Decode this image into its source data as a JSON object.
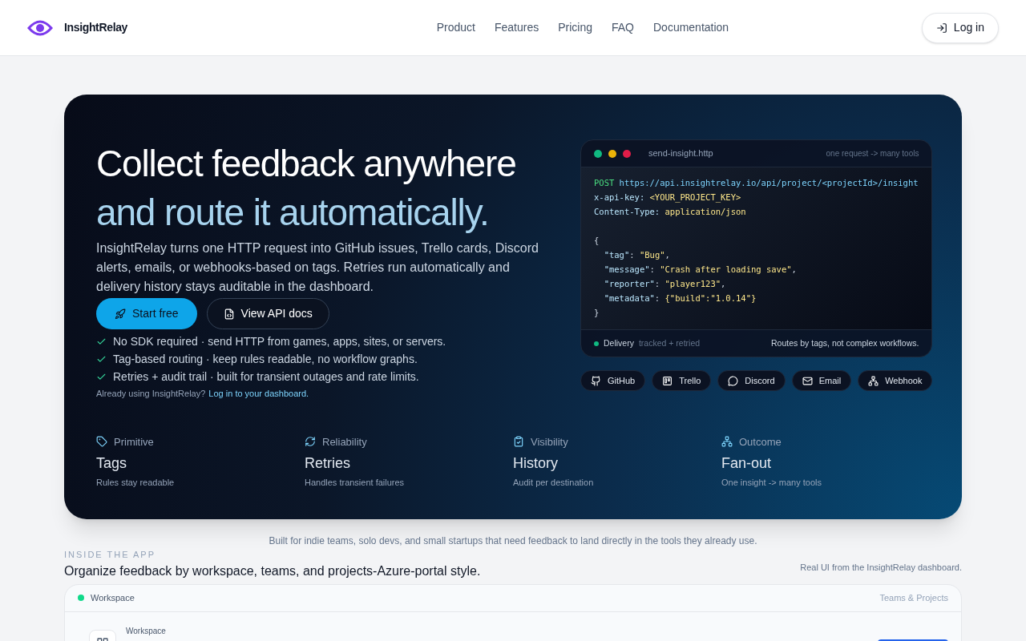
{
  "header": {
    "brand": "InsightRelay",
    "nav": [
      "Product",
      "Features",
      "Pricing",
      "FAQ",
      "Documentation"
    ],
    "login": "Log in"
  },
  "hero": {
    "title_line1": "Collect feedback anywhere",
    "title_line2": "and route it automatically.",
    "description": "InsightRelay turns one HTTP request into GitHub issues, Trello cards, Discord alerts, emails, or webhooks-based on tags. Retries run automatically and delivery history stays auditable in the dashboard.",
    "buttons": [
      {
        "label": "Start free",
        "kind": "primary"
      },
      {
        "label": "View API docs",
        "kind": "secondary"
      }
    ],
    "checks": [
      "No SDK required · send HTTP from games, apps, sites, or servers.",
      "Tag-based routing · keep rules readable, no workflow graphs.",
      "Retries + audit trail · built for transient outages and rate limits."
    ],
    "already": "Already using InsightRelay?",
    "already_link": "Log in to your dashboard.",
    "code_card": {
      "dots": [
        {
          "color": "#10b981"
        },
        {
          "color": "#eab308"
        },
        {
          "color": "#e11d48"
        }
      ],
      "filename": "send-insight.http",
      "tagline": "one request -> many tools",
      "lines": [
        {
          "kind": "code",
          "tokens": [
            {
              "text": "POST ",
              "kind": "method"
            },
            {
              "text": "https://api.insightrelay.io/api/project/<projectId>/insight",
              "kind": "url"
            }
          ]
        },
        {
          "kind": "code",
          "tokens": [
            {
              "text": "x-api-key: ",
              "kind": "key"
            },
            {
              "text": "<YOUR_PROJECT_KEY>",
              "kind": "value"
            }
          ]
        },
        {
          "kind": "code",
          "tokens": [
            {
              "text": "Content-Type: ",
              "kind": "key"
            },
            {
              "text": "application/json",
              "kind": "value"
            }
          ]
        },
        {
          "kind": "blank"
        },
        {
          "kind": "code",
          "tokens": [
            {
              "text": "{",
              "kind": "punct"
            }
          ]
        },
        {
          "kind": "code",
          "tokens": [
            {
              "text": "  \"tag\"",
              "kind": "key"
            },
            {
              "text": ": ",
              "kind": "punct"
            },
            {
              "text": "\"Bug\"",
              "kind": "value"
            },
            {
              "text": ",",
              "kind": "punct"
            }
          ]
        },
        {
          "kind": "code",
          "tokens": [
            {
              "text": "  \"message\"",
              "kind": "key"
            },
            {
              "text": ": ",
              "kind": "punct"
            },
            {
              "text": "\"Crash after loading save\"",
              "kind": "value"
            },
            {
              "text": ",",
              "kind": "punct"
            }
          ]
        },
        {
          "kind": "code",
          "tokens": [
            {
              "text": "  \"reporter\"",
              "kind": "key"
            },
            {
              "text": ": ",
              "kind": "punct"
            },
            {
              "text": "\"player123\"",
              "kind": "value"
            },
            {
              "text": ",",
              "kind": "punct"
            }
          ]
        },
        {
          "kind": "code",
          "tokens": [
            {
              "text": "  \"metadata\"",
              "kind": "key"
            },
            {
              "text": ": ",
              "kind": "punct"
            },
            {
              "text": "{\"build\":\"1.0.14\"}",
              "kind": "value"
            }
          ]
        },
        {
          "kind": "code",
          "tokens": [
            {
              "text": "}",
              "kind": "punct"
            }
          ]
        }
      ],
      "footer_label": "Delivery",
      "footer_status": "tracked + retried",
      "footer_note": "Routes by tags, not complex workflows."
    },
    "integrations": [
      {
        "label": "GitHub",
        "kind": "github"
      },
      {
        "label": "Trello",
        "kind": "trello"
      },
      {
        "label": "Discord",
        "kind": "discord"
      },
      {
        "label": "Email",
        "kind": "email"
      },
      {
        "label": "Webhook",
        "kind": "webhook"
      }
    ],
    "stats": [
      {
        "kind": "tag",
        "label": "Primitive",
        "value": "Tags",
        "note": "Rules stay readable"
      },
      {
        "kind": "retry",
        "label": "Reliability",
        "value": "Retries",
        "note": "Handles transient failures"
      },
      {
        "kind": "history",
        "label": "Visibility",
        "value": "History",
        "note": "Audit per destination"
      },
      {
        "kind": "outcome",
        "label": "Outcome",
        "value": "Fan-out",
        "note": "One insight -> many tools"
      }
    ]
  },
  "caption": "Built for indie teams, solo devs, and small startups that need feedback to land directly in the tools they already use.",
  "inside": {
    "eyebrow": "INSIDE THE APP",
    "heading": "Organize feedback by workspace, teams, and projects-Azure-portal style.",
    "note": "Real UI from the InsightRelay dashboard.",
    "panel": {
      "label": "Workspace",
      "right": "Teams & Projects",
      "section_label": "Workspace"
    }
  }
}
